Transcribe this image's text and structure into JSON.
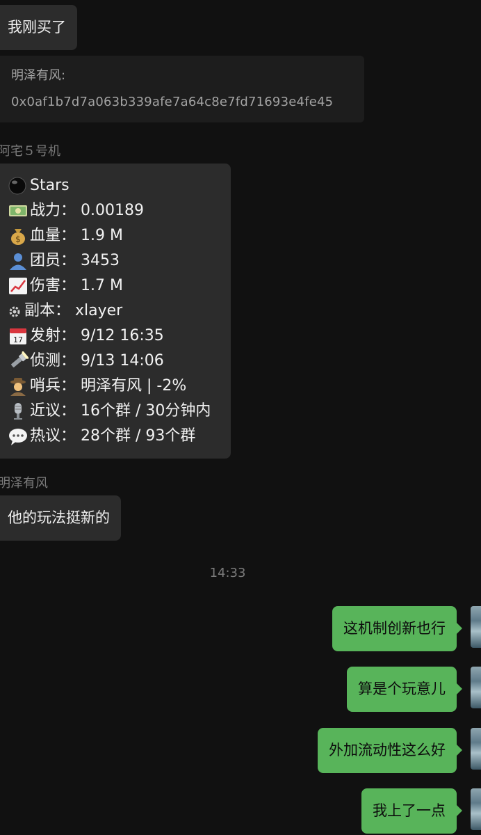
{
  "messages": {
    "first": "我刚买了",
    "quote": {
      "name": "明泽有风:",
      "text": "0x0af1b7d7a063b339afe7a64c8e7fd71693e4fe45"
    },
    "bot_name": "阿宅５号机",
    "card_rows": [
      {
        "icon": "black-circle-icon",
        "text": "Stars"
      },
      {
        "icon": "money-bills-icon",
        "text": "战力：  0.00189"
      },
      {
        "icon": "money-bag-icon",
        "text": "血量：  1.9 M"
      },
      {
        "icon": "person-silhouette-icon",
        "text": "团员：  3453"
      },
      {
        "icon": "chart-up-icon",
        "text": "伤害：  1.7 M"
      },
      {
        "icon": "gear-icon",
        "text": "副本：  xlayer"
      },
      {
        "icon": "calendar-icon",
        "text": "发射：  9/12 16:35"
      },
      {
        "icon": "flashlight-icon",
        "text": "侦测：  9/13 14:06"
      },
      {
        "icon": "detective-icon",
        "text": "哨兵：  明泽有风 | -2%"
      },
      {
        "icon": "microphone-icon",
        "text": "近议：  16个群 / 30分钟内"
      },
      {
        "icon": "speech-bubble-icon",
        "text": "热议：  28个群 / 93个群"
      }
    ],
    "user_name": "明泽有风",
    "user_msg": "他的玩法挺新的",
    "timestamp": "14:33",
    "outgoing": [
      "这机制创新也行",
      "算是个玩意儿",
      "外加流动性这么好",
      "我上了一点"
    ]
  },
  "colors": {
    "background": "#111111",
    "incoming_bubble": "#2c2c2c",
    "outgoing_bubble": "#58b45a",
    "meta_text": "#7b7b7b"
  }
}
